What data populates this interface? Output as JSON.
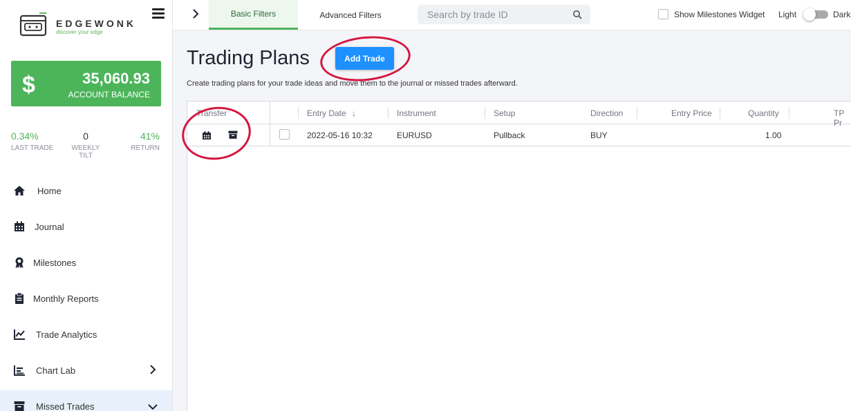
{
  "brand": {
    "name": "EDGEWONK",
    "tagline": "discover your edge"
  },
  "balance": {
    "symbol": "$",
    "amount": "35,060.93",
    "label": "ACCOUNT BALANCE"
  },
  "stats": [
    {
      "value": "0.34%",
      "label": "LAST TRADE"
    },
    {
      "value": "0",
      "label": "WEEKLY TILT"
    },
    {
      "value": "41%",
      "label": "RETURN"
    }
  ],
  "nav": [
    {
      "label": "Home",
      "icon": "home-icon"
    },
    {
      "label": "Journal",
      "icon": "calendar-icon"
    },
    {
      "label": "Milestones",
      "icon": "award-icon"
    },
    {
      "label": "Monthly Reports",
      "icon": "clipboard-icon"
    },
    {
      "label": "Trade Analytics",
      "icon": "line-chart-icon"
    },
    {
      "label": "Chart Lab",
      "icon": "bar-chart-icon"
    },
    {
      "label": "Missed Trades",
      "icon": "archive-icon"
    }
  ],
  "topbar": {
    "tabs": [
      "Basic Filters",
      "Advanced Filters"
    ],
    "search_placeholder": "Search by trade ID",
    "milestones_label": "Show Milestones Widget",
    "mode_light": "Light",
    "mode_dark": "Dark"
  },
  "page": {
    "title": "Trading Plans",
    "add_button": "Add Trade",
    "subtitle": "Create trading plans for your trade ideas and move them to the journal or missed trades afterward."
  },
  "table": {
    "columns": [
      "Transfer",
      "Entry Date",
      "Instrument",
      "Setup",
      "Direction",
      "Entry Price",
      "Quantity",
      "TP Pr"
    ],
    "sort_indicator": "↓",
    "rows": [
      {
        "entry_date": "2022-05-16 10:32",
        "instrument": "EURUSD",
        "setup": "Pullback",
        "direction": "BUY",
        "entry_price": "",
        "quantity": "1.00",
        "tp_price": ""
      }
    ]
  },
  "colors": {
    "brand_green": "#4cb55a",
    "primary_blue": "#1e90ff",
    "annotation_red": "#d4163f"
  }
}
